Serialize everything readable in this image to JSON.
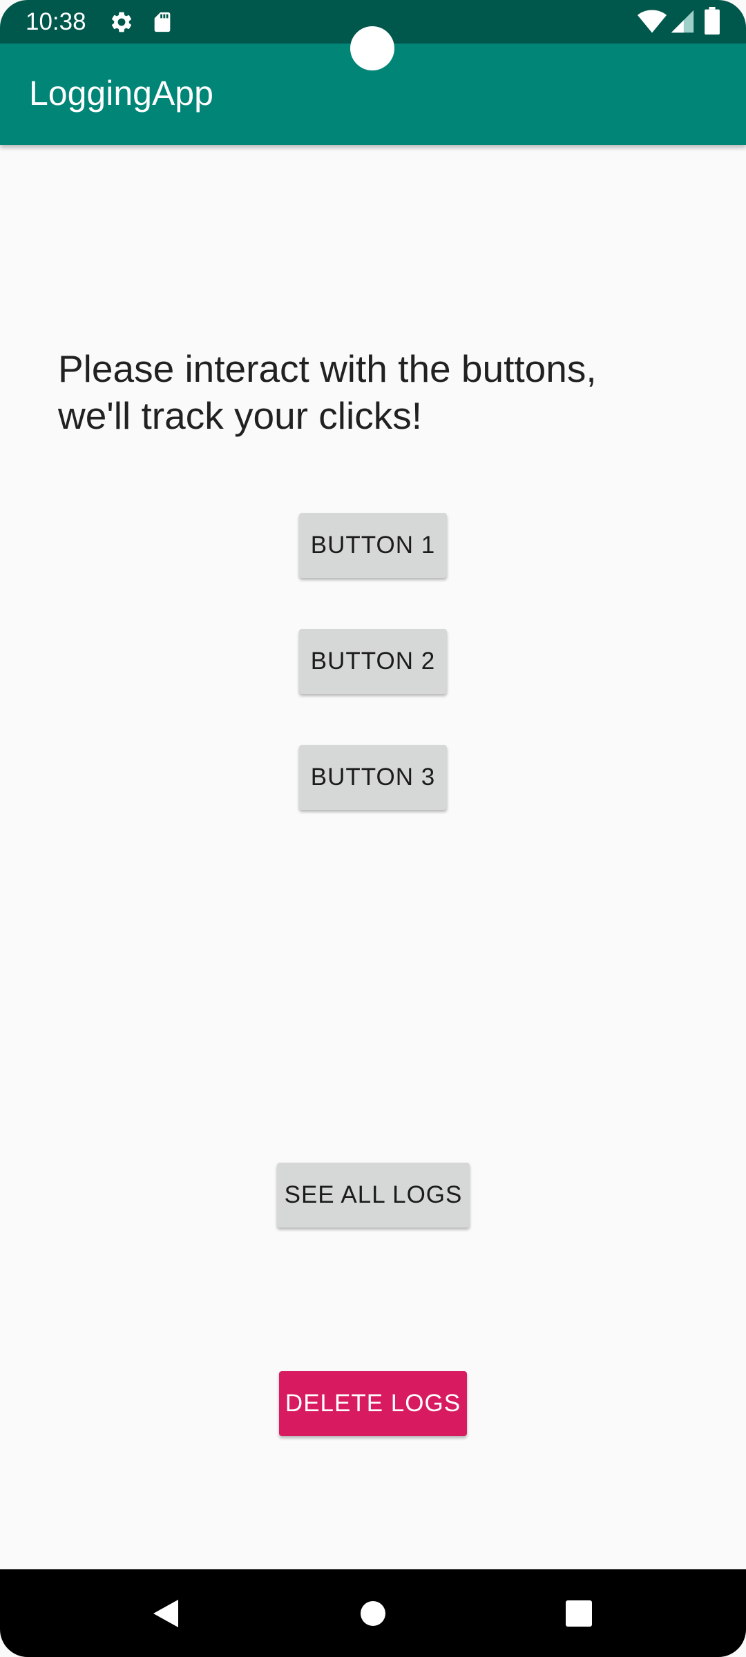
{
  "status_bar": {
    "time": "10:38",
    "icons": [
      "settings-icon",
      "sd-card-icon",
      "wifi-icon",
      "cell-signal-icon",
      "battery-icon"
    ]
  },
  "app_bar": {
    "title": "LoggingApp"
  },
  "main": {
    "instructions": "Please interact with the buttons, we'll track your clicks!",
    "buttons": {
      "button1": "BUTTON 1",
      "button2": "BUTTON 2",
      "button3": "BUTTON 3",
      "see_all_logs": "SEE ALL LOGS",
      "delete_logs": "DELETE LOGS"
    }
  },
  "nav_bar": {
    "icons": [
      "back-icon",
      "home-icon",
      "recents-icon"
    ]
  },
  "colors": {
    "status_bar": "#00574b",
    "app_bar": "#008577",
    "accent": "#d81b60",
    "button_gray": "#d6d7d7",
    "background": "#fafafa"
  }
}
